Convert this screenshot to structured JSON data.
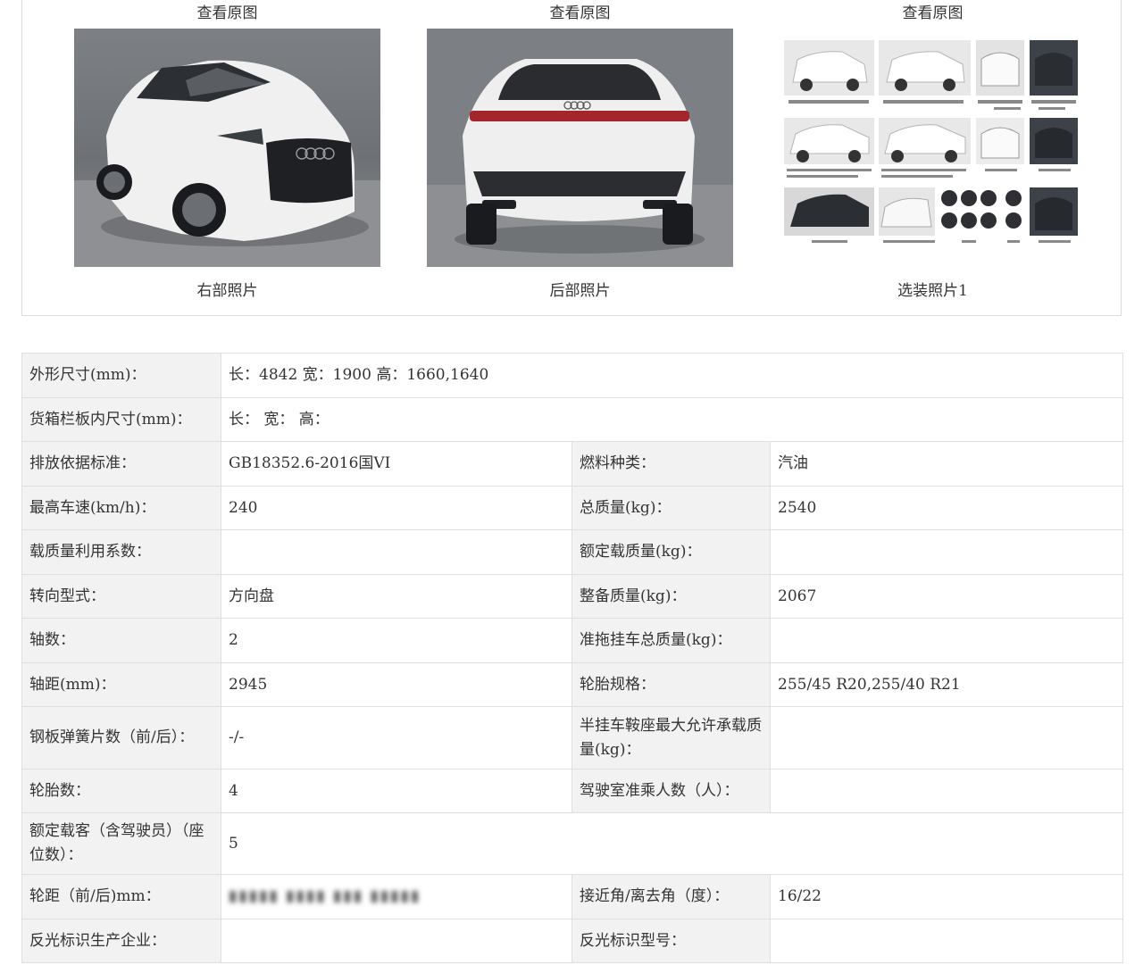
{
  "photos": [
    {
      "view_link": "查看原图",
      "caption": "右部照片"
    },
    {
      "view_link": "查看原图",
      "caption": "后部照片"
    },
    {
      "view_link": "查看原图",
      "caption": "选装照片1"
    }
  ],
  "specs": {
    "dimensions": {
      "label": "外形尺寸(mm)：",
      "value": "长：4842 宽：1900 高：1660,1640"
    },
    "cargo_box": {
      "label": "货箱栏板内尺寸(mm)：",
      "value": "长：  宽：  高："
    },
    "emission": {
      "label": "排放依据标准：",
      "value": "GB18352.6-2016国VI"
    },
    "fuel": {
      "label": "燃料种类：",
      "value": "汽油"
    },
    "max_speed": {
      "label": "最高车速(km/h)：",
      "value": "240"
    },
    "total_mass": {
      "label": "总质量(kg)：",
      "value": "2540"
    },
    "load_util": {
      "label": "载质量利用系数：",
      "value": ""
    },
    "rated_load": {
      "label": "额定载质量(kg)：",
      "value": ""
    },
    "steering": {
      "label": "转向型式：",
      "value": "方向盘"
    },
    "curb_mass": {
      "label": "整备质量(kg)：",
      "value": "2067"
    },
    "axles": {
      "label": "轴数：",
      "value": "2"
    },
    "trailer_mass": {
      "label": "准拖挂车总质量(kg)：",
      "value": ""
    },
    "wheelbase": {
      "label": "轴距(mm)：",
      "value": "2945"
    },
    "tire_spec": {
      "label": "轮胎规格：",
      "value": "255/45 R20,255/40 R21"
    },
    "leaf_springs": {
      "label": "钢板弹簧片数（前/后）：",
      "value": "-/-"
    },
    "semi_trailer": {
      "label": "半挂车鞍座最大允许承载质量(kg)：",
      "value": ""
    },
    "tires": {
      "label": "轮胎数：",
      "value": "4"
    },
    "cab_passengers": {
      "label": "驾驶室准乘人数（人）：",
      "value": ""
    },
    "seats": {
      "label": "额定载客（含驾驶员）（座位数）：",
      "value": "5"
    },
    "track": {
      "label": "轮距（前/后)mm：",
      "value": ""
    },
    "angles": {
      "label": "接近角/离去角（度）：",
      "value": "16/22"
    },
    "reflector_maker": {
      "label": "反光标识生产企业：",
      "value": ""
    },
    "reflector_model": {
      "label": "反光标识型号：",
      "value": ""
    }
  },
  "colors": {
    "label_bg": "#f2f2f2",
    "border": "#dfdfdf",
    "text": "#333333"
  }
}
